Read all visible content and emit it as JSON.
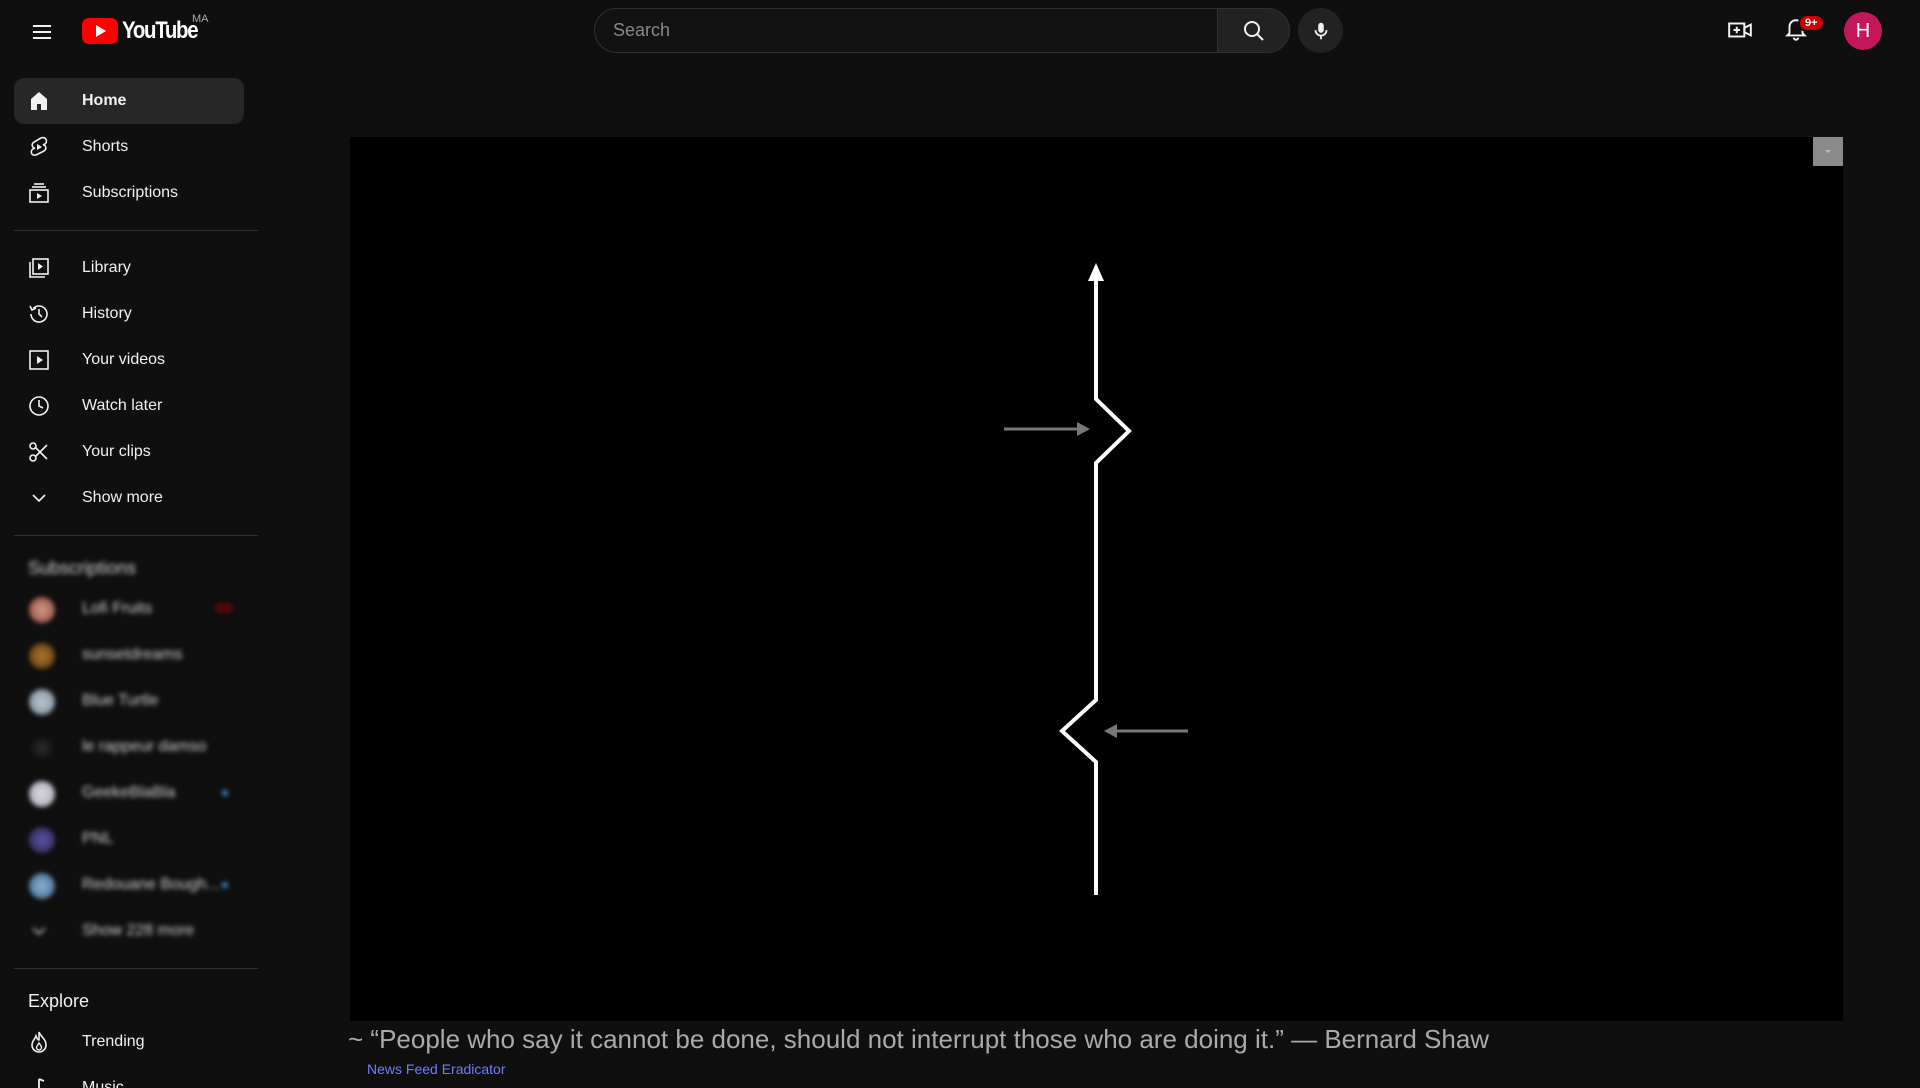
{
  "header": {
    "logo_text": "YouTube",
    "country_code": "MA",
    "search_placeholder": "Search",
    "notification_badge": "9+",
    "avatar_letter": "H",
    "brand_color": "#ff0000",
    "avatar_color": "#c2185b"
  },
  "sidebar": {
    "primary": [
      {
        "label": "Home",
        "icon": "home-icon",
        "active": true
      },
      {
        "label": "Shorts",
        "icon": "shorts-icon"
      },
      {
        "label": "Subscriptions",
        "icon": "subscriptions-icon"
      }
    ],
    "library": [
      {
        "label": "Library",
        "icon": "library-icon"
      },
      {
        "label": "History",
        "icon": "history-icon"
      },
      {
        "label": "Your videos",
        "icon": "your-videos-icon"
      },
      {
        "label": "Watch later",
        "icon": "watch-later-icon"
      },
      {
        "label": "Your clips",
        "icon": "scissors-icon"
      },
      {
        "label": "Show more",
        "icon": "chevron-down-icon"
      }
    ],
    "subscriptions_title": "Subscriptions",
    "subscriptions": [
      {
        "name": "Lofi Fruits",
        "indicator": "live"
      },
      {
        "name": "sunsetdreams",
        "indicator": ""
      },
      {
        "name": "Blue Turtle",
        "indicator": ""
      },
      {
        "name": "le rappeur damso",
        "indicator": ""
      },
      {
        "name": "GeekeBlaBla",
        "indicator": "new"
      },
      {
        "name": "PNL",
        "indicator": ""
      },
      {
        "name": "Redouane Bough...",
        "indicator": "new"
      }
    ],
    "show_more_subs": "Show 228 more",
    "explore_title": "Explore",
    "explore": [
      {
        "label": "Trending",
        "icon": "trending-icon"
      },
      {
        "label": "Music",
        "icon": "music-icon"
      }
    ]
  },
  "main": {
    "quote": "~ “People who say it cannot be done, should not interrupt those who are doing it.” — Bernard Shaw",
    "credit": "News Feed Eradicator"
  }
}
